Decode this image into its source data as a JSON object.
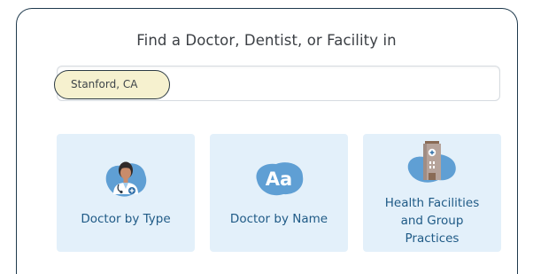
{
  "search": {
    "title": "Find a Doctor, Dentist, or Facility in",
    "location_value": "Stanford, CA"
  },
  "cards": [
    {
      "label": "Doctor by Type",
      "icon": "doctor-icon"
    },
    {
      "label": "Doctor by Name",
      "icon": "aa-text-icon",
      "icon_text": "Aa"
    },
    {
      "label_lines": [
        "Health Facilities",
        "and Group",
        "Practices"
      ],
      "icon": "hospital-building-icon"
    }
  ],
  "colors": {
    "card_background": "#e3f0fa",
    "card_text": "#1f5a86",
    "icon_blob": "#5f9fd4",
    "input_highlight": "#f6f1cf"
  }
}
